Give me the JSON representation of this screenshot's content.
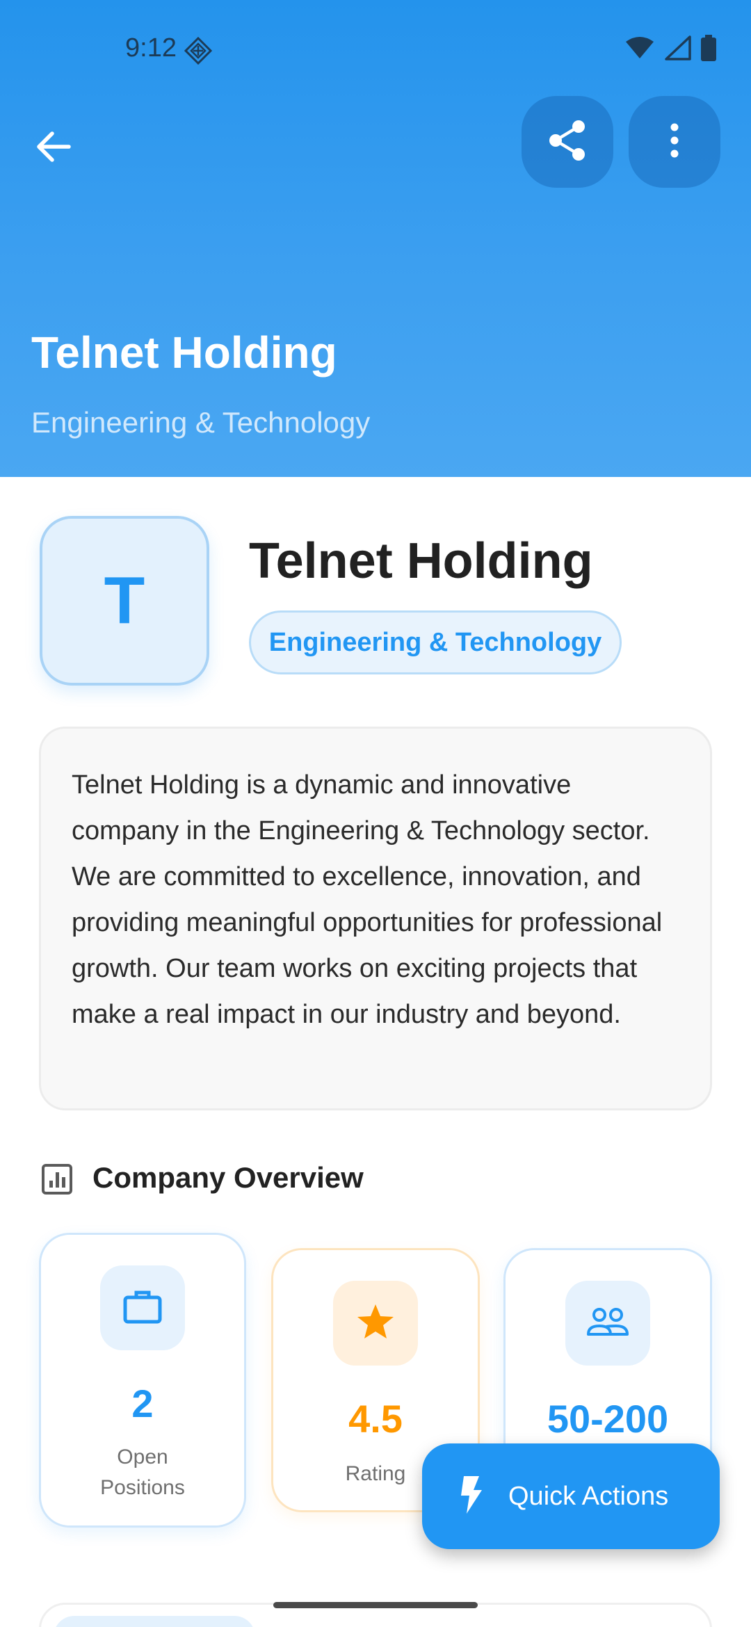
{
  "status_bar": {
    "time": "9:12"
  },
  "header": {
    "title": "Telnet Holding",
    "subtitle": "Engineering & Technology",
    "background_color": "#2493ec"
  },
  "icons": {
    "back": "arrow-back-icon",
    "share": "share-icon",
    "more": "more-vert-icon",
    "overview": "bar-chart-icon",
    "positions": "briefcase-icon",
    "rating": "star-icon",
    "employees": "people-icon",
    "fab": "flash-icon"
  },
  "profile": {
    "logo_letter": "T",
    "name": "Telnet Holding",
    "industry": "Engineering & Technology",
    "accent_color": "#2196f3"
  },
  "description": "Telnet Holding is a dynamic and innovative company in the Engineering & Technology sector. We are committed to excellence, innovation, and providing meaningful opportunities for professional growth. Our team works on exciting projects that make a real impact in our industry and beyond.",
  "overview": {
    "title": "Company Overview",
    "stats": [
      {
        "value": "2",
        "label": "Open Positions",
        "color": "#2196f3"
      },
      {
        "value": "4.5",
        "label": "Rating",
        "color": "#ff9800"
      },
      {
        "value": "50-200",
        "label": "",
        "color": "#2196f3"
      }
    ]
  },
  "fab": {
    "label": "Quick Actions"
  }
}
